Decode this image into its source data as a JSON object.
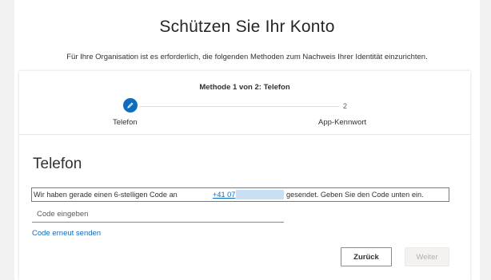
{
  "page": {
    "title": "Schützen Sie Ihr Konto",
    "subtitle": "Für Ihre Organisation ist es erforderlich, die folgenden Methoden zum Nachweis Ihrer Identität einzurichten."
  },
  "wizard": {
    "step_title": "Methode 1 von 2: Telefon",
    "steps": [
      {
        "label": "Telefon",
        "state": "current",
        "icon": "pencil-icon"
      },
      {
        "number": "2",
        "label": "App-Kennwort",
        "state": "pending"
      }
    ]
  },
  "phone": {
    "heading": "Telefon",
    "info_before": "Wir haben gerade einen 6-stelligen Code an",
    "phone_number_visible": "+41 07",
    "info_after": "gesendet. Geben Sie den Code unten ein.",
    "code_placeholder": "Code eingeben",
    "code_value": "",
    "resend_label": "Code erneut senden"
  },
  "buttons": {
    "back_label": "Zurück",
    "next_label": "Weiter",
    "next_enabled": false
  },
  "colors": {
    "accent": "#0f6cbd",
    "redaction": "#c9dff3"
  }
}
